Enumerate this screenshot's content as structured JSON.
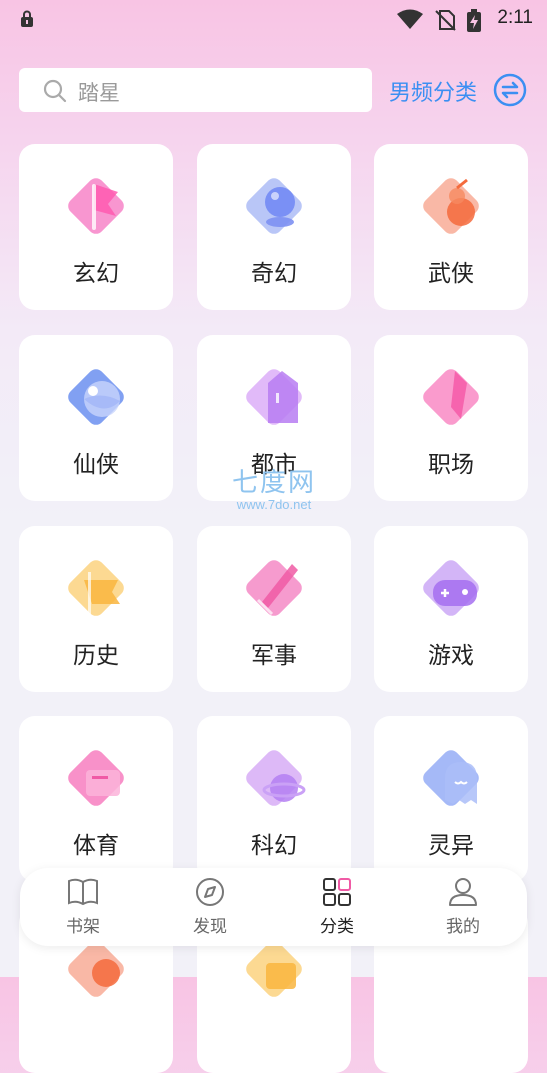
{
  "status_bar": {
    "time": "2:11"
  },
  "search": {
    "placeholder": "踏星"
  },
  "category_switch": {
    "label": "男频分类"
  },
  "categories": [
    {
      "label": "玄幻",
      "icon": "flag-icon"
    },
    {
      "label": "奇幻",
      "icon": "crystal-ball-icon"
    },
    {
      "label": "武侠",
      "icon": "gourd-icon"
    },
    {
      "label": "仙侠",
      "icon": "yin-yang-icon"
    },
    {
      "label": "都市",
      "icon": "building-icon"
    },
    {
      "label": "职场",
      "icon": "tie-icon"
    },
    {
      "label": "历史",
      "icon": "banner-icon"
    },
    {
      "label": "军事",
      "icon": "sword-icon"
    },
    {
      "label": "游戏",
      "icon": "gamepad-icon"
    },
    {
      "label": "体育",
      "icon": "sports-icon"
    },
    {
      "label": "科幻",
      "icon": "planet-icon"
    },
    {
      "label": "灵异",
      "icon": "ghost-icon"
    }
  ],
  "watermark": {
    "main": "七度网",
    "url": "www.7do.net"
  },
  "bottom_nav": [
    {
      "label": "书架",
      "icon": "book-icon"
    },
    {
      "label": "发现",
      "icon": "compass-icon"
    },
    {
      "label": "分类",
      "icon": "grid-icon"
    },
    {
      "label": "我的",
      "icon": "user-icon"
    }
  ],
  "colors": {
    "accent": "#3b8ff2",
    "active_nav_label": "#222222",
    "card_bg": "#ffffff"
  }
}
